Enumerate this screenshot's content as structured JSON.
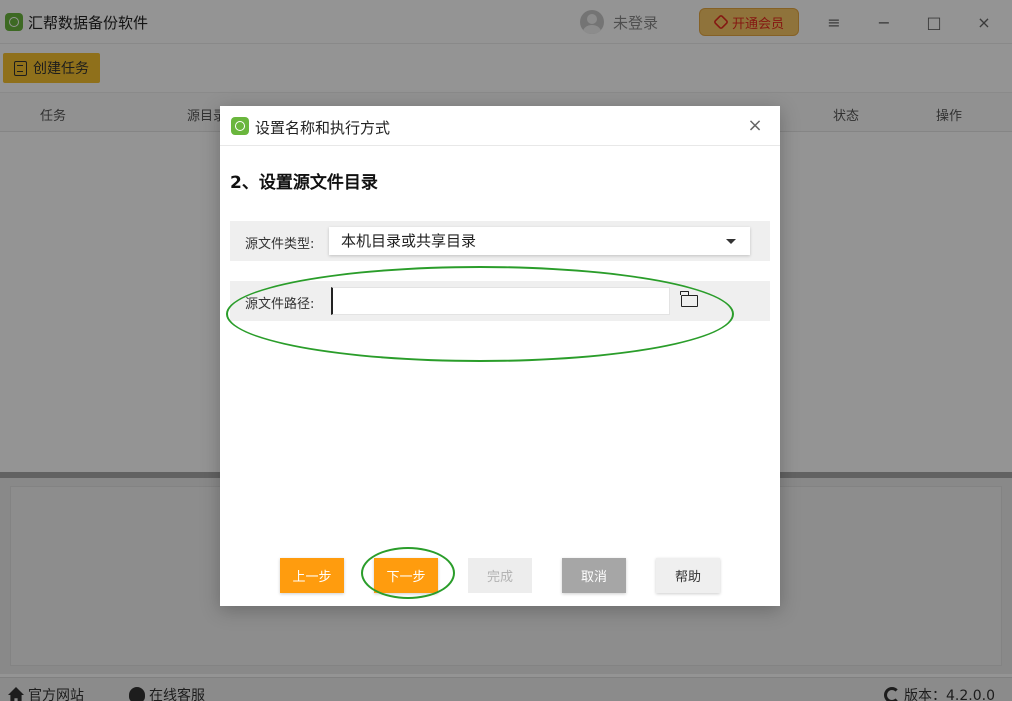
{
  "app": {
    "title": "汇帮数据备份软件",
    "user_label": "未登录",
    "vip_label": "开通会员",
    "colors": {
      "accent": "#f6c22f",
      "primary_button": "#ff9c0e",
      "brand": "#6ab63d",
      "annotation": "#2a9d2a"
    }
  },
  "toolbar": {
    "create_label": "创建任务"
  },
  "table": {
    "headers": {
      "task": "任务",
      "source": "源目录",
      "status": "状态",
      "action": "操作"
    }
  },
  "statusbar": {
    "website": "官方网站",
    "service": "在线客服",
    "version": "版本：4.2.0.0"
  },
  "dialog": {
    "title": "设置名称和执行方式",
    "close": "×",
    "step_heading": "2、设置源文件目录",
    "source_type": {
      "label": "源文件类型:",
      "value": "本机目录或共享目录"
    },
    "source_path": {
      "label": "源文件路径:",
      "value": "",
      "placeholder": ""
    },
    "buttons": {
      "prev": "上一步",
      "next": "下一步",
      "finish": "完成",
      "cancel": "取消",
      "help": "帮助"
    }
  },
  "window_controls": {
    "menu": "≡",
    "minimize": "−",
    "maximize": "□",
    "close": "×"
  }
}
